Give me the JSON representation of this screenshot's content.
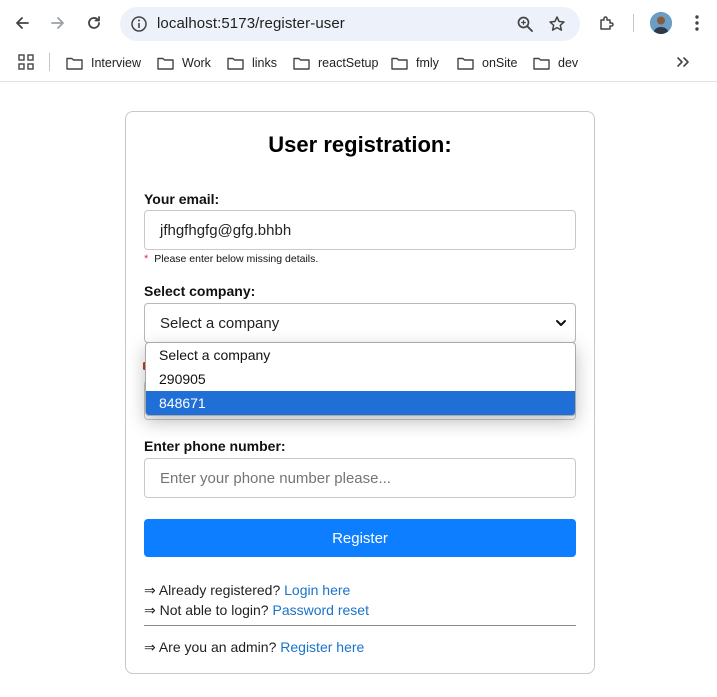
{
  "browser": {
    "url": "localhost:5173/register-user",
    "bookmarks": [
      {
        "label": "Interview"
      },
      {
        "label": "Work"
      },
      {
        "label": "links"
      },
      {
        "label": "reactSetup"
      },
      {
        "label": "fmly"
      },
      {
        "label": "onSite"
      },
      {
        "label": "dev"
      }
    ]
  },
  "form": {
    "title": "User registration:",
    "email_label": "Your email:",
    "email_value": "jfhgfhgfg@gfg.bhbh",
    "error_star": "*",
    "error_text": "Please enter below missing details.",
    "company_label": "Select company:",
    "company_selected": "Select a company",
    "phone_label": "Enter phone number:",
    "phone_placeholder": "Enter your phone number please...",
    "register_button": "Register",
    "already_prefix": "⇒ Already registered? ",
    "login_link": "Login here",
    "notable_prefix": "⇒ Not able to login? ",
    "reset_link": "Password reset",
    "admin_prefix": "⇒ Are you an admin? ",
    "admin_link": "Register here"
  },
  "dropdown": {
    "options": [
      "Select a company",
      "290905",
      "848671"
    ],
    "highlighted_index": 2
  },
  "colors": {
    "accent": "#0d7eff",
    "link": "#1a73c9",
    "highlight": "#1f6fd6",
    "error": "#dc3545"
  }
}
